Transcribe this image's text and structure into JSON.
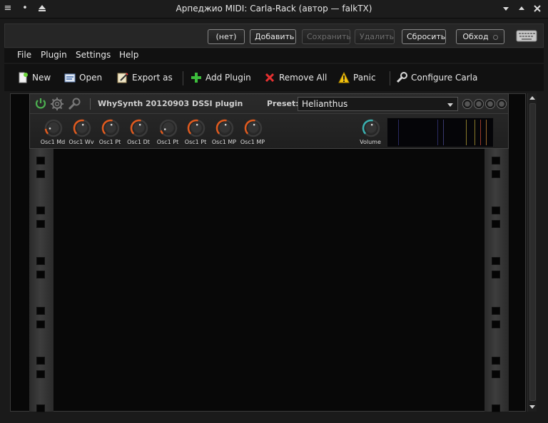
{
  "window": {
    "title": "Арпеджио MIDI: Carla-Rack (автор — falkTX)",
    "icons": [
      "menu-icon",
      "pin-icon",
      "arrow-up-icon",
      "minimize-icon",
      "maximize-icon",
      "close-icon"
    ]
  },
  "top_row": {
    "combo_value": "(нет)",
    "add_label": "Добавить",
    "save_label": "Сохранить",
    "delete_label": "Удалить",
    "reset_label": "Сбросить",
    "bypass_label": "Обход"
  },
  "menubar": {
    "items": [
      "File",
      "Plugin",
      "Settings",
      "Help"
    ]
  },
  "toolbar": {
    "new_label": "New",
    "open_label": "Open",
    "export_label": "Export as",
    "add_plugin_label": "Add Plugin",
    "remove_all_label": "Remove All",
    "panic_label": "Panic",
    "configure_label": "Configure Carla"
  },
  "plugin": {
    "name": "WhySynth 20120903 DSSI plugin",
    "preset_label": "Preset:",
    "preset_value": "Helianthus",
    "knobs": [
      {
        "label": "Osc1 Md",
        "value": 0.15
      },
      {
        "label": "Osc1 Wv",
        "value": 0.55
      },
      {
        "label": "Osc1 Pt",
        "value": 0.55
      },
      {
        "label": "Osc1 Dt",
        "value": 0.55
      },
      {
        "label": "Osc1 Pt",
        "value": 0.1
      },
      {
        "label": "Osc1 Pt",
        "value": 0.55
      },
      {
        "label": "Osc1 MP",
        "value": 0.55
      },
      {
        "label": "Osc1 MP",
        "value": 0.55
      }
    ],
    "volume_label": "Volume",
    "volume_value": 0.55
  },
  "colors": {
    "accent_orange": "#e05a1e",
    "accent_teal": "#3ab0b0",
    "power_green": "#4caf50"
  }
}
